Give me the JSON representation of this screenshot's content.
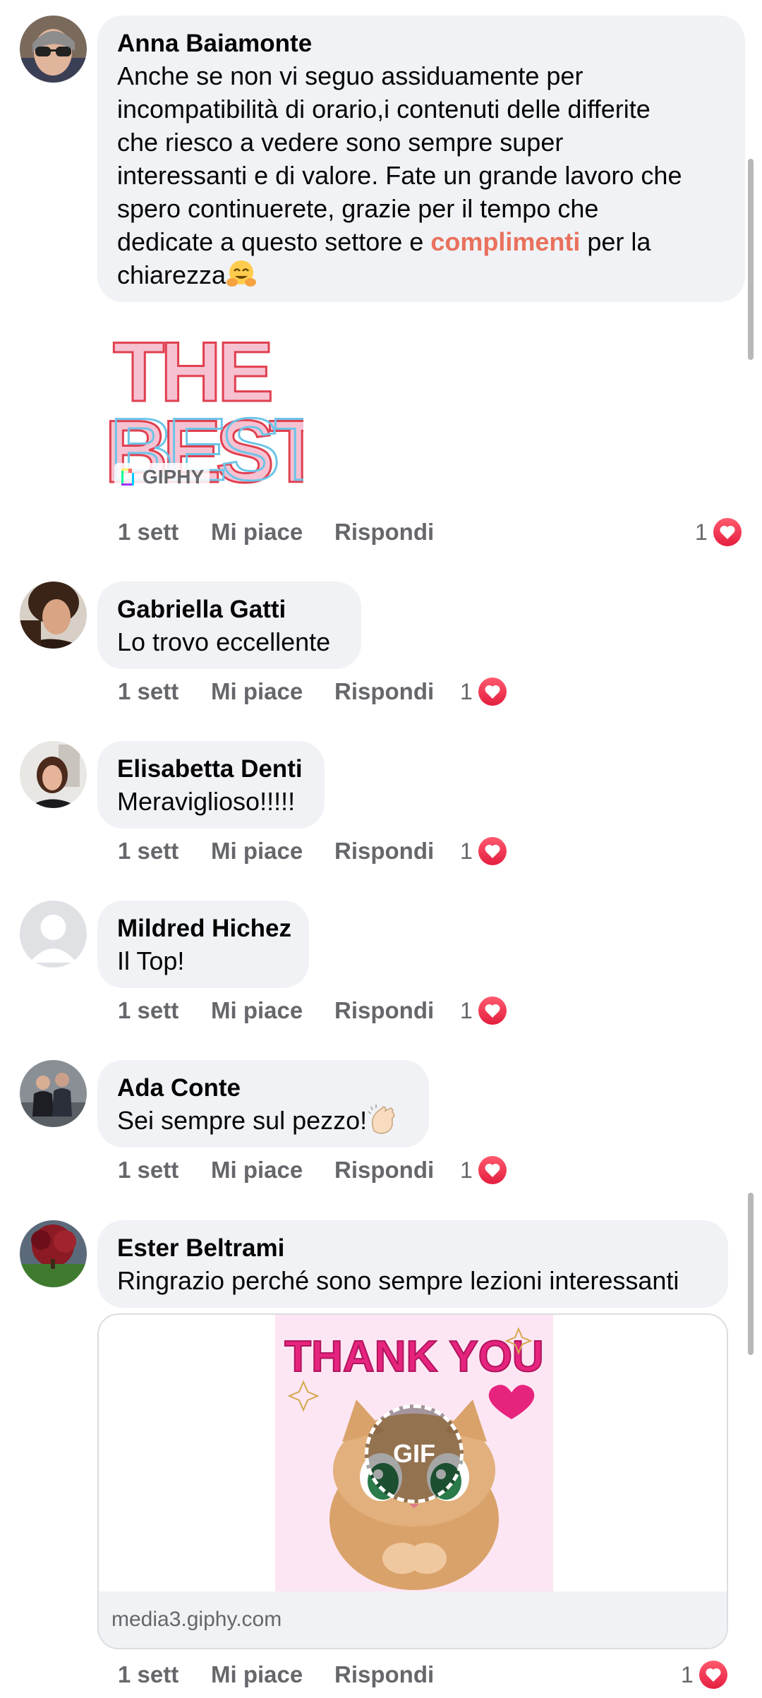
{
  "comments": [
    {
      "author": "Anna Baiamonte",
      "text_lines": [
        "Anche se non vi seguo  assiduamente per",
        "incompatibilità di orario,i contenuti delle differite",
        "che riesco a vedere sono sempre super",
        "interessanti e di valore. Fate un grande lavoro che",
        "spero continuerete, grazie per il tempo che"
      ],
      "line6_before": "dedicate a questo settore e ",
      "line6_highlight": "complimenti",
      "line6_after": " per la",
      "line7": "chiarezza",
      "emoji": "hugging-face-emoji",
      "sticker": {
        "text_top": "THE",
        "text_bottom": "BEST",
        "source": "GIPHY"
      },
      "time": "1 sett",
      "like": "Mi piace",
      "reply": "Rispondi",
      "reactions": "1"
    },
    {
      "author": "Gabriella Gatti",
      "text": "Lo trovo eccellente",
      "time": "1 sett",
      "like": "Mi piace",
      "reply": "Rispondi",
      "reactions": "1"
    },
    {
      "author": "Elisabetta Denti",
      "text": "Meraviglioso!!!!!",
      "time": "1 sett",
      "like": "Mi piace",
      "reply": "Rispondi",
      "reactions": "1"
    },
    {
      "author": "Mildred Hichez",
      "text": "Il Top!",
      "time": "1 sett",
      "like": "Mi piace",
      "reply": "Rispondi",
      "reactions": "1"
    },
    {
      "author": "Ada Conte",
      "text": "Sei sempre sul pezzo!",
      "emoji": "clapping-hands-emoji",
      "time": "1 sett",
      "like": "Mi piace",
      "reply": "Rispondi",
      "reactions": "1"
    },
    {
      "author": "Ester Beltrami",
      "text": "Ringrazio perché sono sempre lezioni interessanti",
      "gif": {
        "title": "THANK YOU",
        "badge": "GIF",
        "domain": "media3.giphy.com"
      },
      "time": "1 sett",
      "like": "Mi piace",
      "reply": "Rispondi",
      "reactions": "1"
    }
  ],
  "colors": {
    "bubble": "#f0f2f5",
    "highlight": "#e9715d",
    "meta_text": "#65676b",
    "heart": "#e41e3f"
  }
}
